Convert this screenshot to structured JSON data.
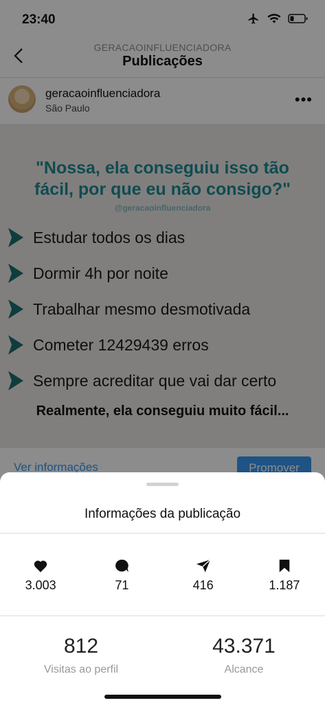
{
  "status_bar": {
    "time": "23:40"
  },
  "nav": {
    "account": "GERACAOINFLUENCIADORA",
    "title": "Publicações"
  },
  "post_header": {
    "username": "geracaoinfluenciadora",
    "location": "São Paulo"
  },
  "post_image": {
    "quote_line1": "\"Nossa, ela conseguiu isso tão",
    "quote_line2": "fácil, por que eu não consigo?\"",
    "handle": "@geracaoinfluenciadora",
    "items": [
      "Estudar todos os dias",
      "Dormir 4h por noite",
      "Trabalhar mesmo desmotivada",
      "Cometer 12429439 erros",
      "Sempre acreditar que vai dar certo"
    ],
    "conclusion": "Realmente, ela conseguiu muito fácil..."
  },
  "post_actions": {
    "view_info": "Ver informações",
    "promote": "Promover"
  },
  "sheet": {
    "title": "Informações da publicação",
    "stats": [
      {
        "icon": "heart-icon",
        "value": "3.003"
      },
      {
        "icon": "comment-icon",
        "value": "71"
      },
      {
        "icon": "share-icon",
        "value": "416"
      },
      {
        "icon": "bookmark-icon",
        "value": "1.187"
      }
    ],
    "profile_visits": {
      "value": "812",
      "label": "Visitas ao perfil"
    },
    "reach": {
      "value": "43.371",
      "label": "Alcance"
    }
  },
  "colors": {
    "accent": "#3897f0",
    "quote": "#1c8a93"
  }
}
